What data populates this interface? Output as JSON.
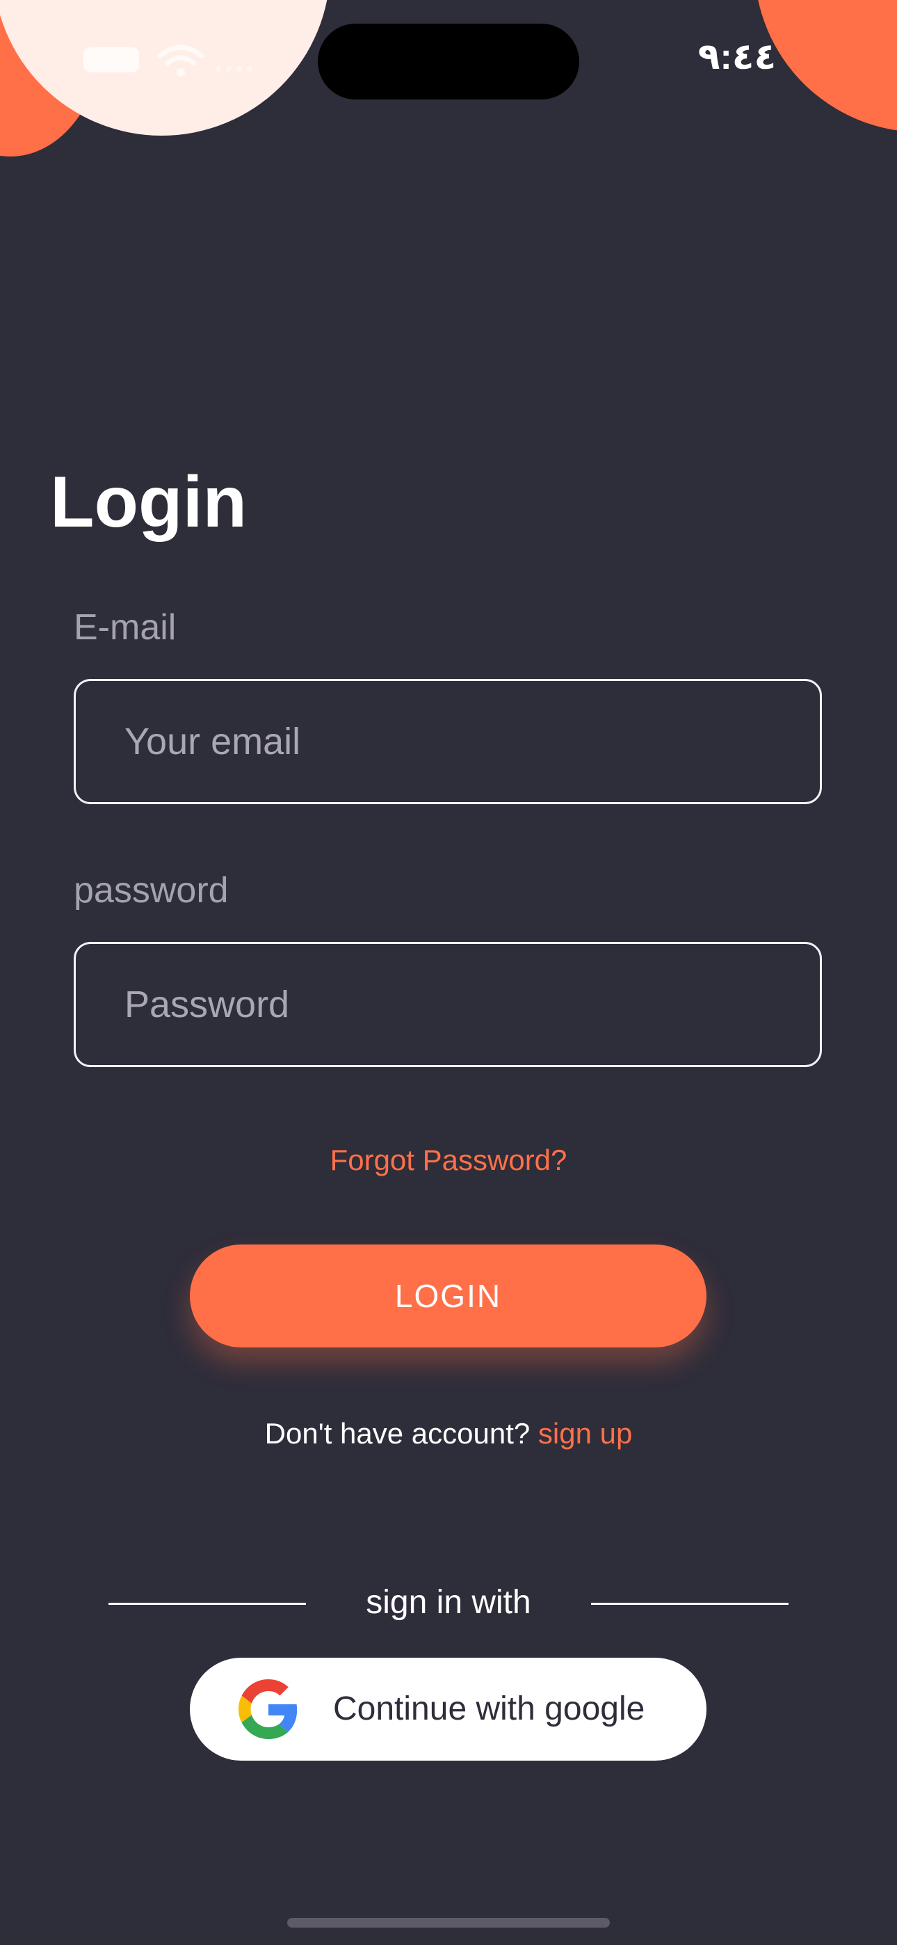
{
  "status_bar": {
    "time": "٩:٤٤"
  },
  "login": {
    "title": "Login",
    "email_label": "E-mail",
    "email_placeholder": "Your email",
    "email_value": "",
    "password_label": "password",
    "password_placeholder": "Password",
    "password_value": "",
    "forgot_password": "Forgot Password?",
    "login_button": "LOGIN",
    "no_account_text": "Don't have account?",
    "signup_link": "sign up"
  },
  "social": {
    "divider_text": "sign in with",
    "google_button": "Continue with google",
    "google_icon": "google-icon"
  },
  "colors": {
    "background": "#2e2d3a",
    "accent": "#ff7048",
    "accent_light": "#ffeee7",
    "text_primary": "#ffffff",
    "text_muted": "#a4a3ac"
  }
}
